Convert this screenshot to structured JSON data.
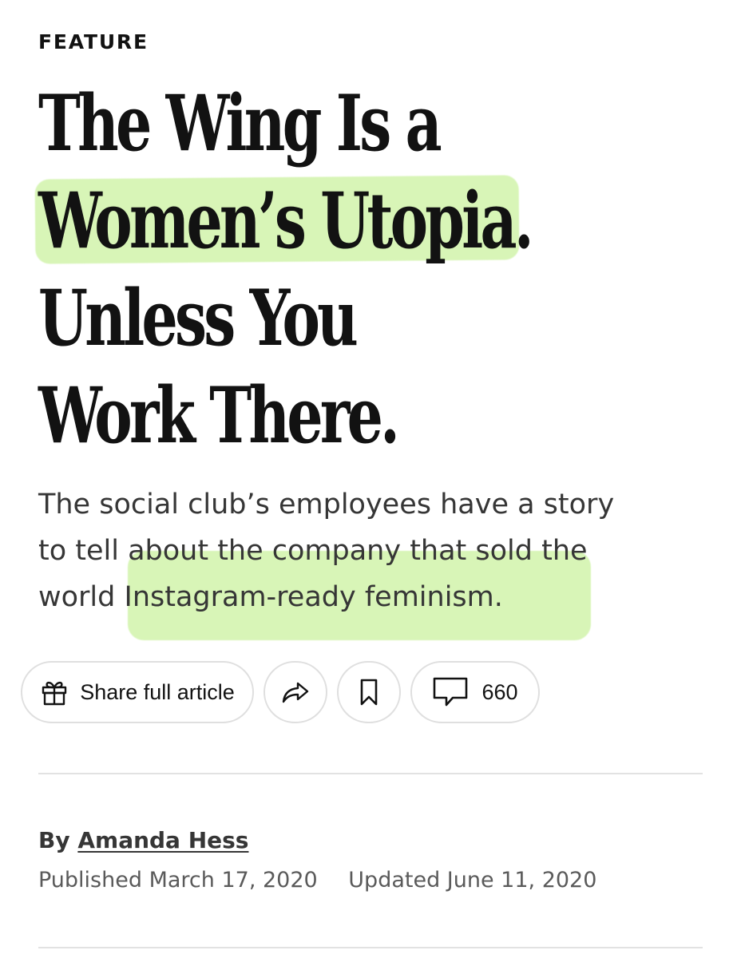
{
  "article": {
    "kicker": "FEATURE",
    "headline": {
      "line1": "The Wing Is a",
      "line2": "Women’s Utopia.",
      "line3": "Unless You",
      "line4": "Work There."
    },
    "summary": {
      "line1": "The social club’s employees have a story",
      "line2": "to tell about the company that sold the",
      "line3": "world Instagram-ready feminism."
    },
    "highlight_color": "#d8f5b7",
    "actions": {
      "share_full_label": "Share full article",
      "comment_count": "660",
      "icons": {
        "gift": "gift-icon",
        "share": "share-arrow-icon",
        "bookmark": "bookmark-icon",
        "comment": "comment-icon"
      }
    },
    "byline": {
      "prefix": "By",
      "author": "Amanda Hess"
    },
    "dates": {
      "published": "Published March 17, 2020",
      "updated": "Updated June 11, 2020"
    }
  }
}
